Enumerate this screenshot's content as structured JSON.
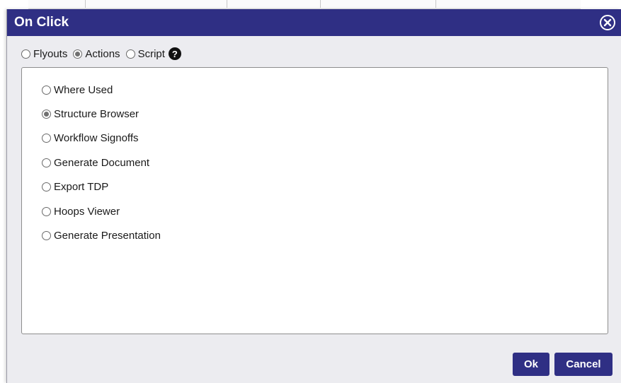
{
  "dialog": {
    "title": "On Click",
    "close_icon": "close-circle-icon"
  },
  "mode": {
    "options": [
      {
        "label": "Flyouts",
        "checked": false
      },
      {
        "label": "Actions",
        "checked": true
      },
      {
        "label": "Script",
        "checked": false
      }
    ],
    "help_icon": "question-mark-icon",
    "help_glyph": "?"
  },
  "actions": {
    "items": [
      {
        "label": "Where Used",
        "checked": false
      },
      {
        "label": "Structure Browser",
        "checked": true
      },
      {
        "label": "Workflow Signoffs",
        "checked": false
      },
      {
        "label": "Generate Document",
        "checked": false
      },
      {
        "label": "Export TDP",
        "checked": false
      },
      {
        "label": "Hoops Viewer",
        "checked": false
      },
      {
        "label": "Generate Presentation",
        "checked": false
      }
    ]
  },
  "footer": {
    "ok_label": "Ok",
    "cancel_label": "Cancel"
  },
  "colors": {
    "titlebar": "#2f2f84",
    "button": "#2f2f84",
    "dialog_bg": "#ececf0"
  }
}
